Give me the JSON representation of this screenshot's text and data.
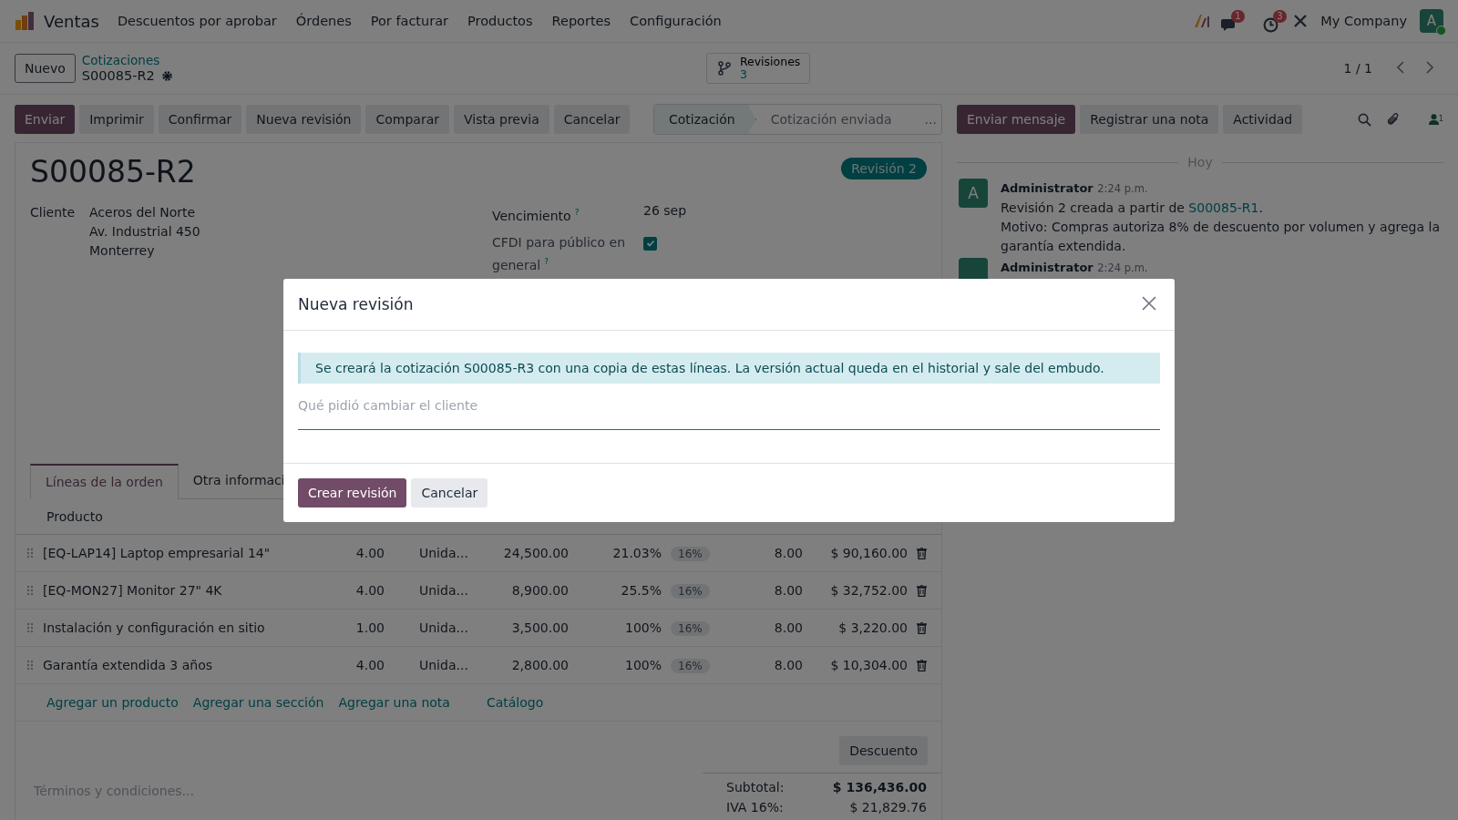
{
  "navbar": {
    "app": "Ventas",
    "menu": [
      "Descuentos por aprobar",
      "Órdenes",
      "Por facturar",
      "Productos",
      "Reportes",
      "Configuración"
    ],
    "messages_count": "1",
    "activities_count": "3",
    "company": "My Company",
    "avatar": "A"
  },
  "control_panel": {
    "new_button": "Nuevo",
    "breadcrumb": "Cotizaciones",
    "record": "S00085-R2",
    "revisions": {
      "label": "Revisiones",
      "count": "3"
    },
    "pager": "1 / 1"
  },
  "actions": [
    {
      "label": "Enviar",
      "primary": true
    },
    {
      "label": "Imprimir",
      "primary": false
    },
    {
      "label": "Confirmar",
      "primary": false
    },
    {
      "label": "Nueva revisión",
      "primary": false
    },
    {
      "label": "Comparar",
      "primary": false
    },
    {
      "label": "Vista previa",
      "primary": false
    },
    {
      "label": "Cancelar",
      "primary": false
    }
  ],
  "statusbar": {
    "stages": [
      {
        "label": "Cotización",
        "selected": true
      },
      {
        "label": "Cotización enviada",
        "selected": false
      }
    ],
    "more": "..."
  },
  "form": {
    "title": "S00085-R2",
    "ribbon": "Revisión 2",
    "customer": {
      "label": "Cliente",
      "lines": [
        "Aceros del Norte",
        "Av. Industrial 450",
        "Monterrey"
      ]
    },
    "expiration": {
      "label": "Vencimiento",
      "help": "?",
      "value": "26 sep"
    },
    "cfdi": {
      "label": "CFDI para público en general",
      "help": "?",
      "checked": true
    },
    "tabs": [
      {
        "label": "Líneas de la orden",
        "selected": true
      },
      {
        "label": "Otra informaci",
        "selected": false
      }
    ],
    "lines": {
      "columns": [
        "Producto"
      ],
      "rows": [
        {
          "product": "[EQ-LAP14] Laptop empresarial 14\"",
          "quantity": "4.00",
          "unit": "Unida...",
          "price": "24,500.00",
          "discount": "21.03%",
          "tax": "16%",
          "column_7": "8.00",
          "subtotal": "$ 90,160.00"
        },
        {
          "product": "[EQ-MON27] Monitor 27\" 4K",
          "quantity": "4.00",
          "unit": "Unida...",
          "price": "8,900.00",
          "discount": "25.5%",
          "tax": "16%",
          "column_7": "8.00",
          "subtotal": "$ 32,752.00"
        },
        {
          "product": "Instalación y configuración en sitio",
          "quantity": "1.00",
          "unit": "Unida...",
          "price": "3,500.00",
          "discount": "100%",
          "tax": "16%",
          "column_7": "8.00",
          "subtotal": "$ 3,220.00"
        },
        {
          "product": "Garantía extendida 3 años",
          "quantity": "4.00",
          "unit": "Unida...",
          "price": "2,800.00",
          "discount": "100%",
          "tax": "16%",
          "column_7": "8.00",
          "subtotal": "$ 10,304.00"
        }
      ]
    },
    "add_links": [
      "Agregar un producto",
      "Agregar una sección",
      "Agregar una nota",
      "Catálogo"
    ],
    "discount_button": "Descuento",
    "terms_placeholder": "Términos y condiciones...",
    "totals": [
      {
        "label": "Subtotal:",
        "value": "$ 136,436.00",
        "bold": true
      },
      {
        "label": "IVA 16%:",
        "value": "$ 21,829.76",
        "bold": false
      }
    ]
  },
  "chatter": {
    "buttons": [
      {
        "label": "Enviar mensaje",
        "primary": true
      },
      {
        "label": "Registrar una nota",
        "primary": false
      },
      {
        "label": "Actividad",
        "primary": false
      }
    ],
    "followers": "1",
    "date_separator": "Hoy",
    "messages": [
      {
        "avatar": "A",
        "author": "Administrator",
        "time": "2:24 p.m.",
        "text": "Revisión 2 creada a partir de ",
        "link": "S00085-R1",
        "after": ".",
        "reason": "Motivo: Compras autoriza 8% de descuento por volumen y agrega la garantía extendida."
      },
      {
        "author": "Administrator",
        "time": "2:24 p.m."
      }
    ]
  },
  "dialog": {
    "title": "Nueva revisión",
    "alert": "Se creará la cotización S00085-R3 con una copia de estas líneas. La versión actual queda en el historial y sale del embudo.",
    "placeholder": "Qué pidió cambiar el cliente",
    "buttons": [
      {
        "label": "Crear revisión",
        "primary": true
      },
      {
        "label": "Cancelar",
        "primary": false
      }
    ]
  }
}
